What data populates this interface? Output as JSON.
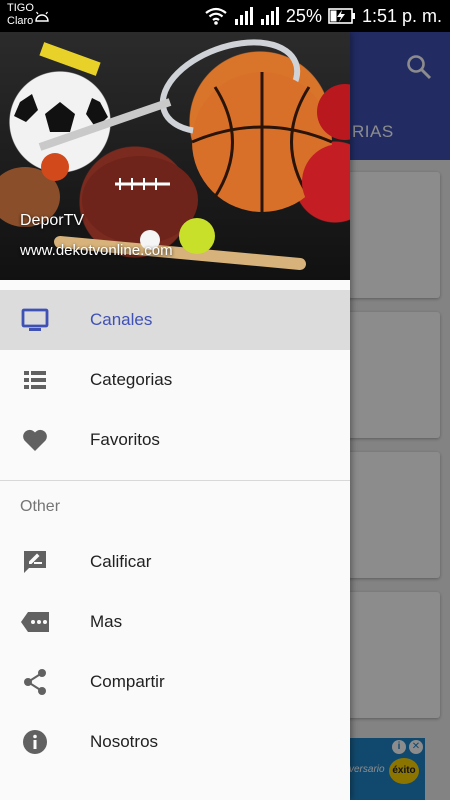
{
  "status_bar": {
    "carrier_1": "TIGO",
    "carrier_2": "Claro",
    "battery": "25%",
    "time": "1:51 p. m."
  },
  "background_app": {
    "tab_label": "RIAS",
    "accent_color": "#3f51b5",
    "ad": {
      "text": "versario",
      "logo": "éxito"
    }
  },
  "drawer": {
    "header": {
      "title": "DeporTV",
      "subtitle": "www.dekotvonline.com"
    },
    "primary_items": [
      {
        "label": "Canales",
        "icon": "tv-icon",
        "active": true
      },
      {
        "label": "Categorias",
        "icon": "list-icon",
        "active": false
      },
      {
        "label": "Favoritos",
        "icon": "heart-icon",
        "active": false
      }
    ],
    "section_label": "Other",
    "secondary_items": [
      {
        "label": "Calificar",
        "icon": "rate-review-icon"
      },
      {
        "label": "Mas",
        "icon": "more-tag-icon"
      },
      {
        "label": "Compartir",
        "icon": "share-icon"
      },
      {
        "label": "Nosotros",
        "icon": "info-icon"
      }
    ]
  }
}
